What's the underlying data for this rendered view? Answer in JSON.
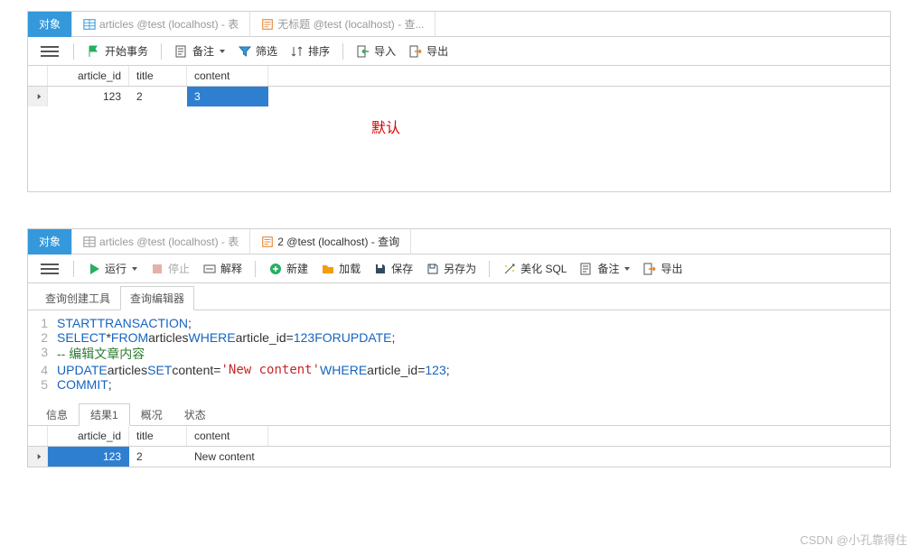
{
  "panel1": {
    "tabs": [
      {
        "label": "对象",
        "active": true
      },
      {
        "label": "articles @test (localhost) - 表",
        "icon": "table"
      },
      {
        "label": "无标题 @test (localhost) - 查...",
        "icon": "query"
      }
    ],
    "toolbar": {
      "begin_tx": "开始事务",
      "notes": "备注",
      "filter": "筛选",
      "sort": "排序",
      "import": "导入",
      "export": "导出"
    },
    "columns": [
      "article_id",
      "title",
      "content"
    ],
    "row": {
      "article_id": "123",
      "title": "2",
      "content": "3"
    },
    "annotation": "默认"
  },
  "panel2": {
    "tabs": [
      {
        "label": "对象",
        "active": true
      },
      {
        "label": "articles @test (localhost) - 表",
        "icon": "table"
      },
      {
        "label": "2 @test (localhost) - 查询",
        "icon": "query"
      }
    ],
    "toolbar": {
      "run": "运行",
      "stop": "停止",
      "explain": "解释",
      "new": "新建",
      "load": "加载",
      "save": "保存",
      "saveas": "另存为",
      "beautify": "美化 SQL",
      "notes": "备注",
      "export": "导出"
    },
    "subtabs": {
      "builder": "查询创建工具",
      "editor": "查询编辑器"
    },
    "sql": {
      "l1_kw1": "START",
      "l1_kw2": "TRANSACTION",
      "l2_select": "SELECT",
      "l2_star": "*",
      "l2_from": "FROM",
      "l2_tbl": "articles",
      "l2_where": "WHERE",
      "l2_col": "article_id",
      "l2_eq": "=",
      "l2_val": "123",
      "l2_for": "FOR",
      "l2_upd": "UPDATE",
      "l3_comment": "-- 编辑文章内容",
      "l4_update": "UPDATE",
      "l4_tbl": "articles",
      "l4_set": "SET",
      "l4_col": "content",
      "l4_eq": "=",
      "l4_str": "'New content'",
      "l4_where": "WHERE",
      "l4_col2": "article_id",
      "l4_eq2": "=",
      "l4_val": "123",
      "l5_commit": "COMMIT"
    },
    "result_tabs": {
      "info": "信息",
      "result1": "结果1",
      "profile": "概况",
      "status": "状态"
    },
    "columns": [
      "article_id",
      "title",
      "content"
    ],
    "row": {
      "article_id": "123",
      "title": "2",
      "content": "New content"
    }
  },
  "watermark": "CSDN @小孔靠得住"
}
